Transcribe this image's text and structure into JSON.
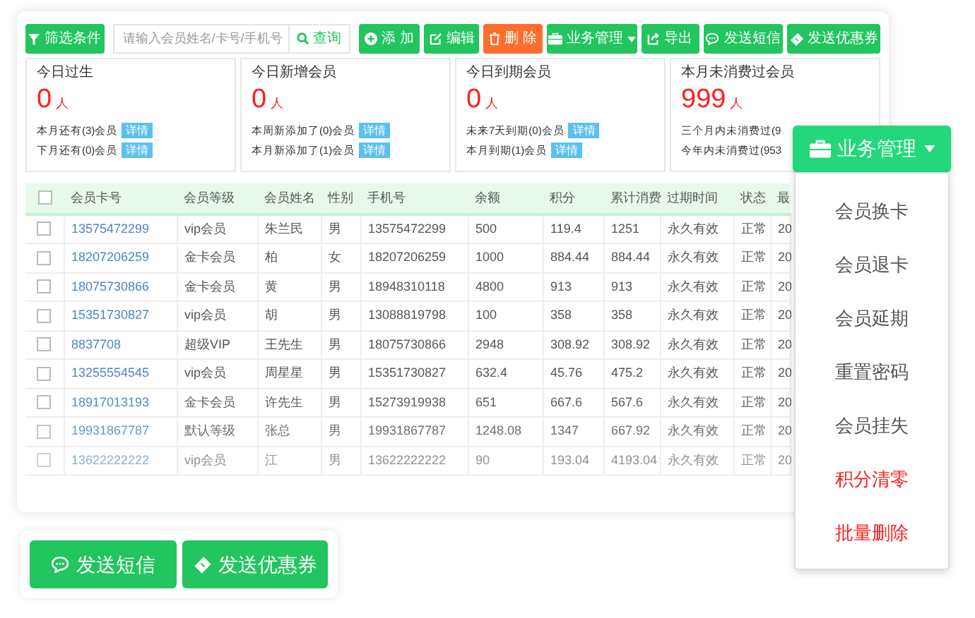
{
  "toolbar": {
    "filter": {
      "label": "筛选条件"
    },
    "search": {
      "placeholder": "请输入会员姓名/卡号/手机号",
      "button": "查询"
    },
    "buttons": [
      {
        "kind": "add",
        "label": "添 加"
      },
      {
        "kind": "edit",
        "label": "编辑"
      },
      {
        "kind": "delete",
        "label": "删 除"
      },
      {
        "kind": "menu",
        "label": "业务管理"
      },
      {
        "kind": "export",
        "label": "导出"
      },
      {
        "kind": "sms",
        "label": "发送短信"
      },
      {
        "kind": "coupon",
        "label": "发送优惠券"
      }
    ]
  },
  "stat_cards": [
    {
      "title": "今日过生",
      "count": "0",
      "unit": "人",
      "lines": [
        {
          "text": "本月还有(3)会员",
          "link": "详情"
        },
        {
          "text": "下月还有(0)会员",
          "link": "详情"
        }
      ]
    },
    {
      "title": "今日新增会员",
      "count": "0",
      "unit": "人",
      "lines": [
        {
          "text": "本周新添加了(0)会员",
          "link": "详情"
        },
        {
          "text": "本月新添加了(1)会员",
          "link": "详情"
        }
      ]
    },
    {
      "title": "今日到期会员",
      "count": "0",
      "unit": "人",
      "lines": [
        {
          "text": "未来7天到期(0)会员",
          "link": "详情"
        },
        {
          "text": "本月到期(1)会员",
          "link": "详情"
        }
      ]
    },
    {
      "title": "本月未消费过会员",
      "count": "999",
      "unit": "人",
      "lines": [
        {
          "text": "三个月内未消费过(9"
        },
        {
          "text": "今年内未消费过(953"
        }
      ]
    }
  ],
  "table": {
    "select_all": {
      "checked": false
    },
    "columns": [
      "会员卡号",
      "会员等级",
      "会员姓名",
      "性别",
      "手机号",
      "余额",
      "积分",
      "累计消费",
      "过期时间",
      "状态",
      "最"
    ],
    "rows": [
      {
        "checked": false,
        "cells": [
          "13575472299",
          "vip会员",
          "朱兰民",
          "男",
          "13575472299",
          "500",
          "119.4",
          "1251",
          "永久有效",
          "正常",
          "20"
        ]
      },
      {
        "checked": false,
        "cells": [
          "18207206259",
          "金卡会员",
          "柏",
          "女",
          "18207206259",
          "1000",
          "884.44",
          "884.44",
          "永久有效",
          "正常",
          "20"
        ]
      },
      {
        "checked": false,
        "cells": [
          "18075730866",
          "金卡会员",
          "黄",
          "男",
          "18948310118",
          "4800",
          "913",
          "913",
          "永久有效",
          "正常",
          "20"
        ]
      },
      {
        "checked": false,
        "cells": [
          "15351730827",
          "vip会员",
          "胡",
          "男",
          "13088819798",
          "100",
          "358",
          "358",
          "永久有效",
          "正常",
          "20"
        ]
      },
      {
        "checked": false,
        "cells": [
          "8837708",
          "超级VIP",
          "王先生",
          "男",
          "18075730866",
          "2948",
          "308.92",
          "308.92",
          "永久有效",
          "正常",
          "20"
        ]
      },
      {
        "checked": false,
        "cells": [
          "13255554545",
          "vip会员",
          "周星星",
          "男",
          "15351730827",
          "632.4",
          "45.76",
          "475.2",
          "永久有效",
          "正常",
          "20"
        ]
      },
      {
        "checked": false,
        "cells": [
          "18917013193",
          "金卡会员",
          "许先生",
          "男",
          "15273919938",
          "651",
          "667.6",
          "567.6",
          "永久有效",
          "正常",
          "20"
        ]
      },
      {
        "checked": false,
        "cells": [
          "19931867787",
          "默认等级",
          "张总",
          "男",
          "19931867787",
          "1248.08",
          "1347",
          "667.92",
          "永久有效",
          "正常",
          "20"
        ]
      },
      {
        "checked": false,
        "cells": [
          "13622222222",
          "vip会员",
          "江",
          "男",
          "13622222222",
          "90",
          "193.04",
          "4193.04",
          "永久有效",
          "正常",
          "20"
        ]
      }
    ]
  },
  "dropdown": {
    "label": "业务管理",
    "expanded": true,
    "items": [
      {
        "kind": "normal",
        "label": "会员换卡"
      },
      {
        "kind": "normal",
        "label": "会员退卡"
      },
      {
        "kind": "normal",
        "label": "会员延期"
      },
      {
        "kind": "normal",
        "label": "重置密码"
      },
      {
        "kind": "normal",
        "label": "会员挂失"
      },
      {
        "kind": "danger",
        "label": "积分清零"
      },
      {
        "kind": "danger",
        "label": "批量删除"
      }
    ]
  },
  "bottom_buttons": [
    {
      "kind": "sms",
      "label": "发送短信"
    },
    {
      "kind": "coupon",
      "label": "发送优惠券"
    }
  ]
}
